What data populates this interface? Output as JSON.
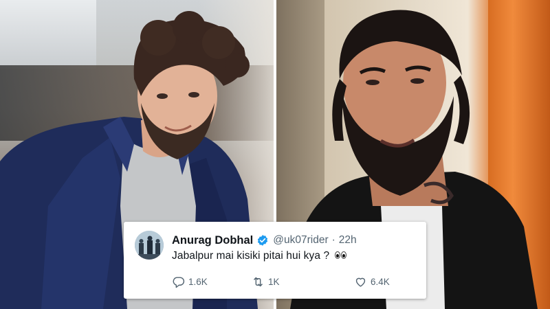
{
  "tweet": {
    "author_name": "Anurag Dobhal",
    "handle": "@uk07rider",
    "separator": "·",
    "time": "22h",
    "text": "Jabalpur mai kisiki pitai hui kya ?",
    "emoji_name": "eyes-emoji",
    "verified": true,
    "actions": {
      "replies": "1.6K",
      "retweets": "1K",
      "likes": "6.4K"
    }
  },
  "colors": {
    "verified_blue": "#1d9bf0",
    "text_primary": "#0f1419",
    "text_secondary": "#536471",
    "card_bg": "#ffffff"
  },
  "icons": {
    "reply": "speech-bubble-icon",
    "retweet": "retweet-arrows-icon",
    "like": "heart-icon",
    "verified": "verified-badge-icon"
  }
}
